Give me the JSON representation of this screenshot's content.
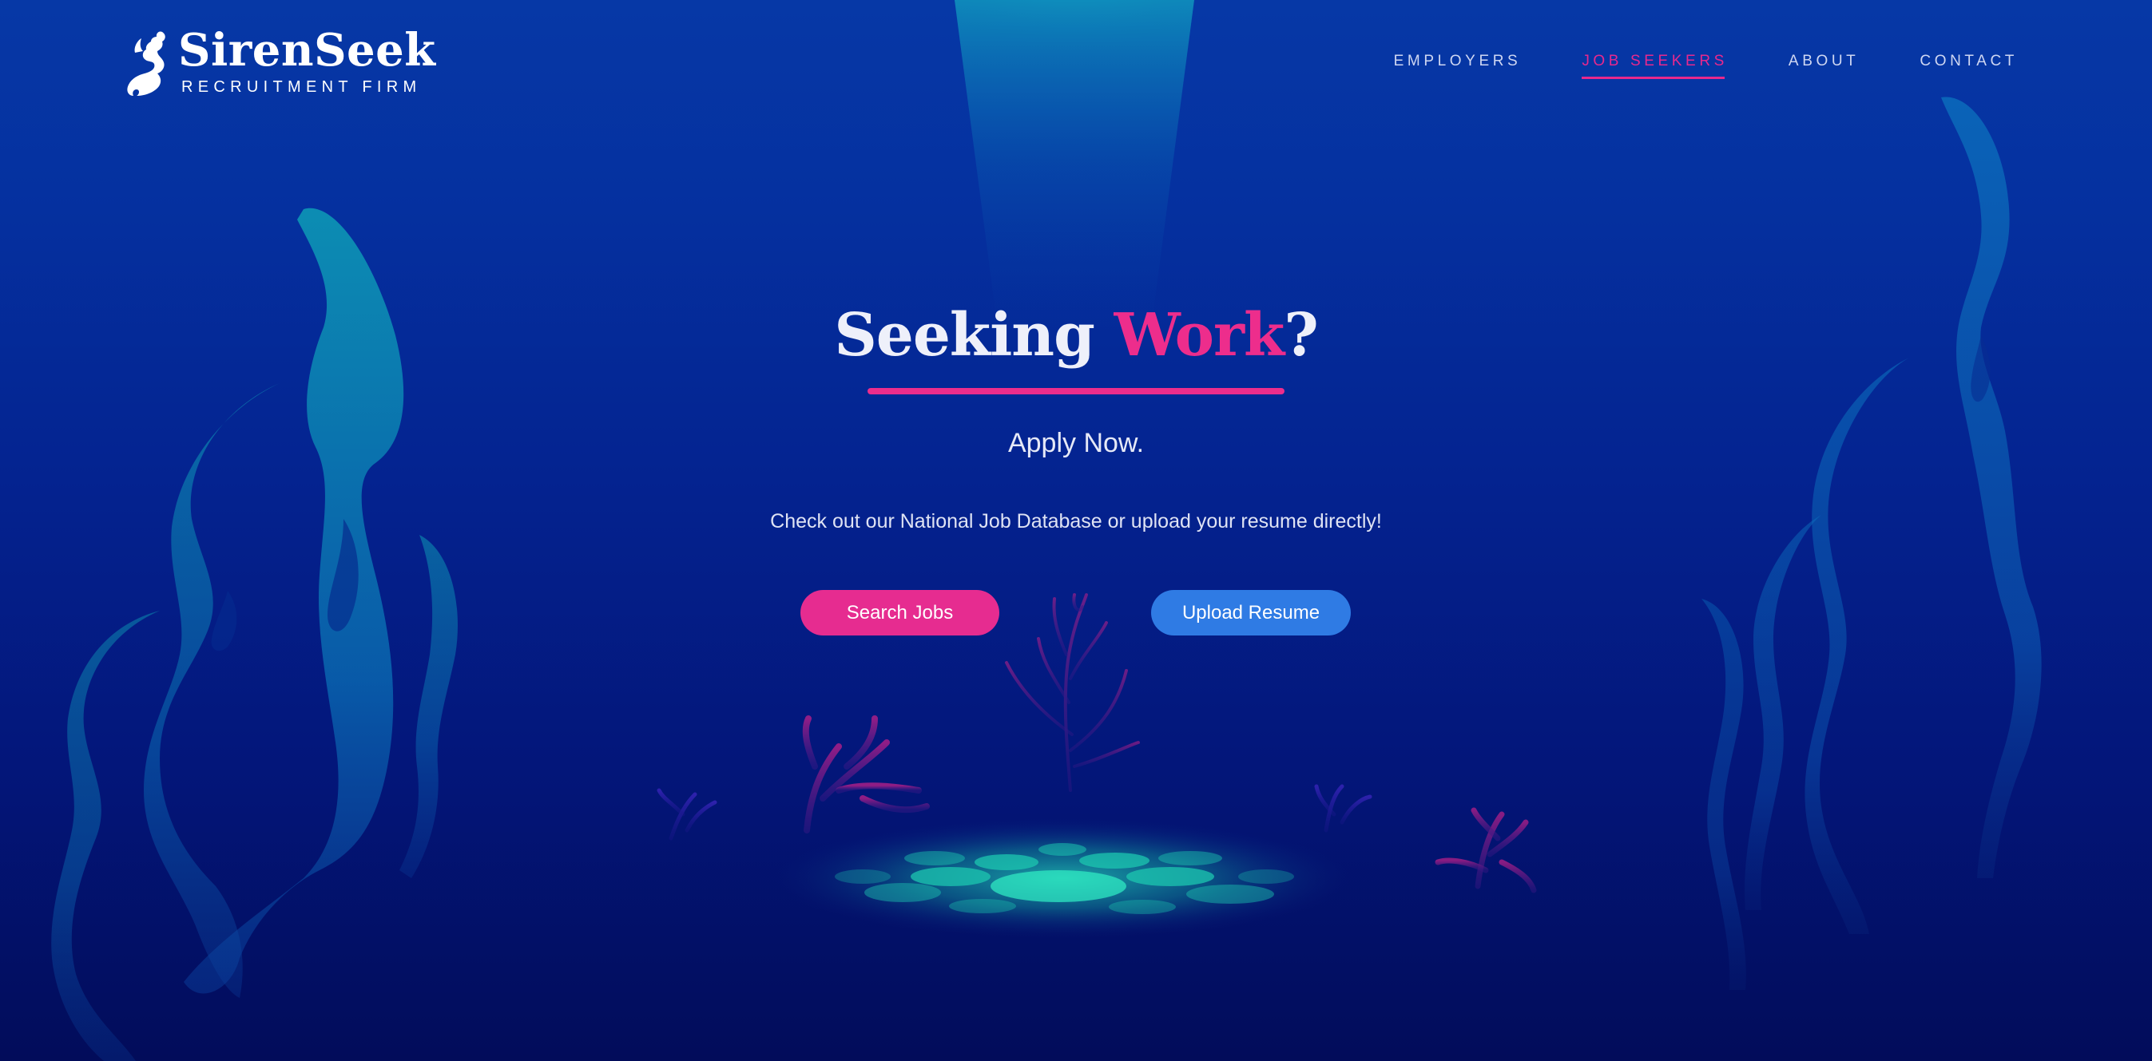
{
  "brand": {
    "name": "SirenSeek",
    "tagline": "RECRUITMENT FIRM",
    "logo_icon": "mermaid-icon"
  },
  "nav": {
    "items": [
      {
        "label": "EMPLOYERS",
        "active": false
      },
      {
        "label": "JOB SEEKERS",
        "active": true
      },
      {
        "label": "ABOUT",
        "active": false
      },
      {
        "label": "CONTACT",
        "active": false
      }
    ]
  },
  "hero": {
    "headline_part1": "Seeking ",
    "headline_accent": "Work",
    "headline_part2": "?",
    "subheading": "Apply Now.",
    "description": "Check out our National Job Database or upload your resume directly!"
  },
  "actions": {
    "search_label": "Search Jobs",
    "upload_label": "Upload Resume"
  },
  "colors": {
    "accent_pink": "#ed2d8c",
    "button_blue": "#2f7be4",
    "background_top": "#0638a6",
    "background_bottom": "#020c5a",
    "kelp_teal": "#0e96b0"
  }
}
